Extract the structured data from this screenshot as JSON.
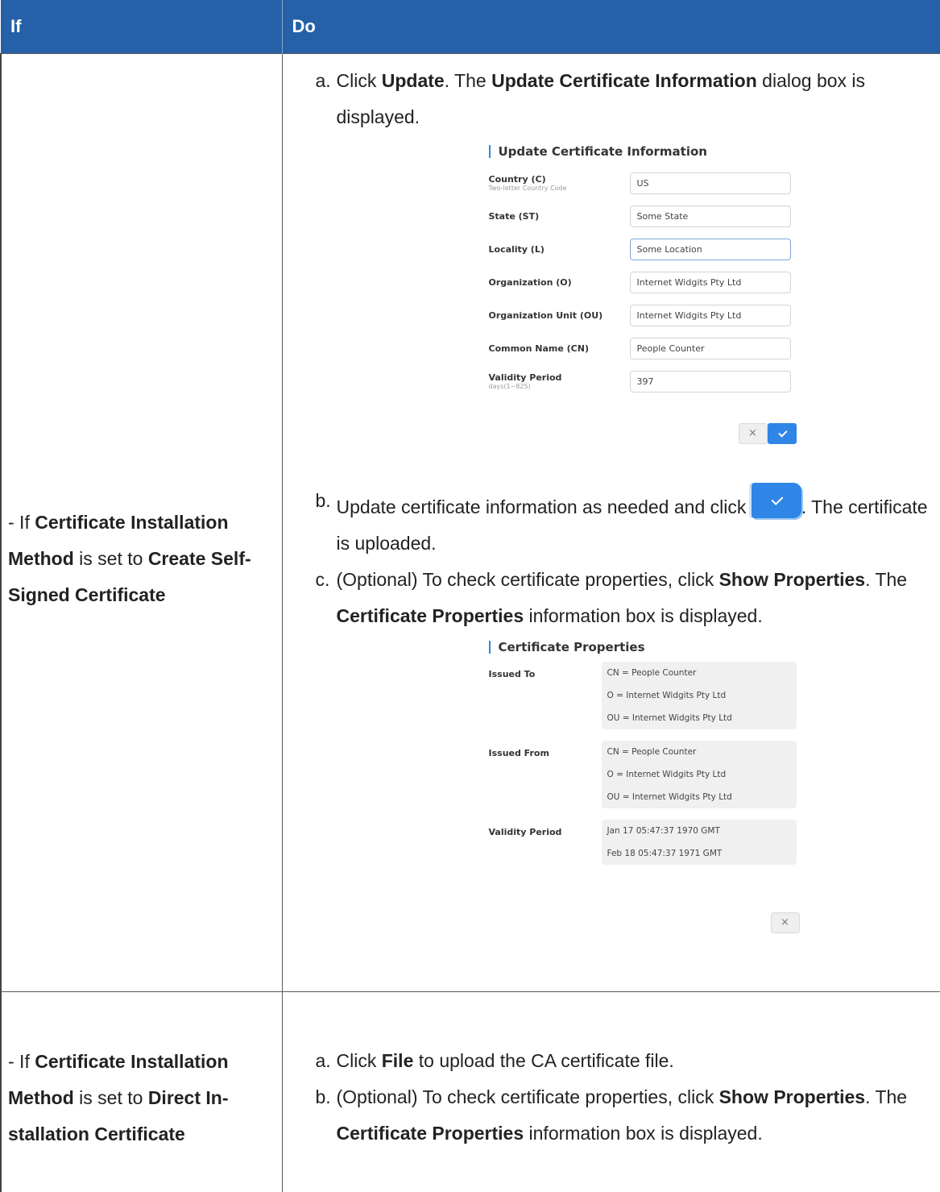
{
  "header": {
    "if": "If",
    "do": "Do"
  },
  "row1": {
    "if_parts": [
      {
        "t": "- If ",
        "b": false
      },
      {
        "t": "Certificate Installation Method",
        "b": true
      },
      {
        "t": " is set to ",
        "b": false
      },
      {
        "t": "Create Self-Signed Certificate",
        "b": true
      }
    ],
    "steps": [
      {
        "marker": "a.",
        "parts": [
          {
            "t": "Click ",
            "b": false
          },
          {
            "t": "Update",
            "b": true
          },
          {
            "t": ". The ",
            "b": false
          },
          {
            "t": "Update Certificate Information",
            "b": true
          },
          {
            "t": " dialog box is displayed.",
            "b": false
          }
        ]
      },
      {
        "marker": "b.",
        "parts": [
          {
            "t": "Update certificate information as needed and click ",
            "b": false
          },
          {
            "icon": "ok-button-icon"
          },
          {
            "t": ". The certificate is uploaded.",
            "b": false
          }
        ]
      },
      {
        "marker": "c.",
        "parts": [
          {
            "t": "(Optional) To check certificate properties, click ",
            "b": false
          },
          {
            "t": "Show Proper­ties",
            "b": true
          },
          {
            "t": ". The ",
            "b": false
          },
          {
            "t": "Certificate Properties",
            "b": true
          },
          {
            "t": " information box is displayed.",
            "b": false
          }
        ]
      }
    ]
  },
  "update_dialog": {
    "title": "Update Certificate Information",
    "fields": [
      {
        "label": "Country (C)",
        "sub": "Two-letter Country Code",
        "value": "US"
      },
      {
        "label": "State (ST)",
        "sub": "",
        "value": "Some State"
      },
      {
        "label": "Locality (L)",
        "sub": "",
        "value": "Some Location",
        "active": true
      },
      {
        "label": "Organization (O)",
        "sub": "",
        "value": "Internet Widgits Pty Ltd"
      },
      {
        "label": "Organization Unit (OU)",
        "sub": "",
        "value": "Internet Widgits Pty Ltd"
      },
      {
        "label": "Common Name (CN)",
        "sub": "",
        "value": "People Counter"
      },
      {
        "label": "Validity Period",
        "sub": "days(1~825)",
        "value": "397"
      }
    ],
    "cancel_label": "×",
    "confirm_icon": "check-icon"
  },
  "properties_dialog": {
    "title": "Certificate Properties",
    "groups": [
      {
        "label": "Issued To",
        "lines": [
          "CN = People Counter",
          "O = Internet Widgits Pty Ltd",
          "OU = Internet Widgits Pty Ltd"
        ]
      },
      {
        "label": "Issued From",
        "lines": [
          "CN = People Counter",
          "O = Internet Widgits Pty Ltd",
          "OU = Internet Widgits Pty Ltd"
        ]
      },
      {
        "label": "Validity Period",
        "lines": [
          "Jan 17 05:47:37 1970 GMT",
          "Feb 18 05:47:37 1971 GMT"
        ]
      }
    ],
    "close_label": "×"
  },
  "row2": {
    "if_parts": [
      {
        "t": "- If ",
        "b": false
      },
      {
        "t": "Certificate Installation Method",
        "b": true
      },
      {
        "t": " is set to ",
        "b": false
      },
      {
        "t": "Direct In­stallation Certificate",
        "b": true
      }
    ],
    "steps": [
      {
        "marker": "a.",
        "parts": [
          {
            "t": "Click ",
            "b": false
          },
          {
            "t": "File",
            "b": true
          },
          {
            "t": " to upload the CA certificate file.",
            "b": false
          }
        ]
      },
      {
        "marker": "b.",
        "parts": [
          {
            "t": "(Optional) To check certificate properties, click ",
            "b": false
          },
          {
            "t": "Show Proper­ties",
            "b": true
          },
          {
            "t": ". The ",
            "b": false
          },
          {
            "t": "Certificate Properties",
            "b": true
          },
          {
            "t": " information box is displayed.",
            "b": false
          }
        ]
      }
    ]
  }
}
